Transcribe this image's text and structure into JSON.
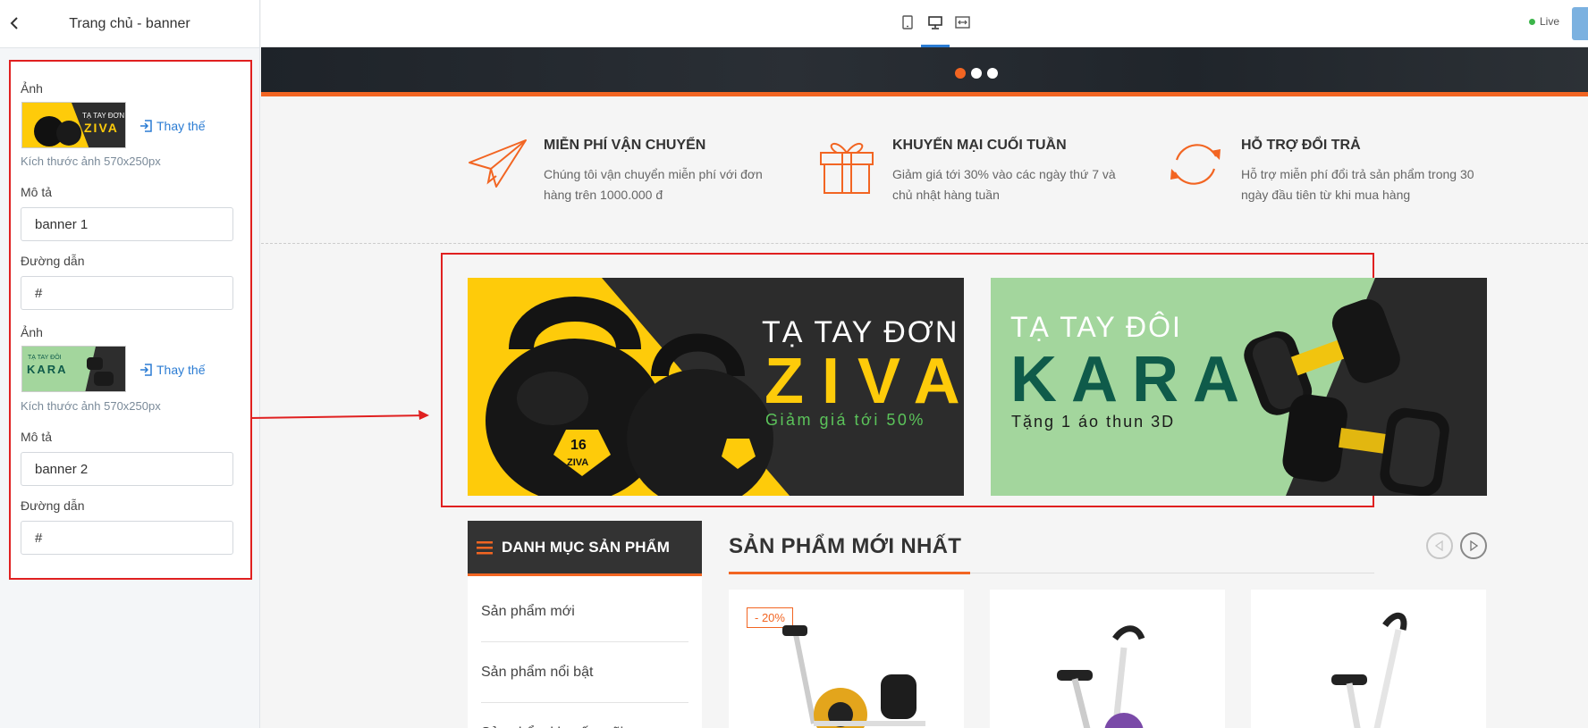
{
  "sidebar": {
    "title": "Trang chủ - banner",
    "banners": [
      {
        "image_label": "Ảnh",
        "replace_label": "Thay thế",
        "size_hint": "Kích thước ảnh 570x250px",
        "desc_label": "Mô tả",
        "desc_value": "banner 1",
        "link_label": "Đường dẫn",
        "link_value": "#"
      },
      {
        "image_label": "Ảnh",
        "replace_label": "Thay thế",
        "size_hint": "Kích thước ảnh 570x250px",
        "desc_label": "Mô tả",
        "desc_value": "banner 2",
        "link_label": "Đường dẫn",
        "link_value": "#"
      }
    ]
  },
  "topbar": {
    "live_label": "Live",
    "devices": [
      "mobile-icon",
      "desktop-icon",
      "fullwidth-icon"
    ],
    "active_device": "desktop"
  },
  "preview": {
    "slider_dots": 3,
    "features": [
      {
        "icon": "paper-plane-icon",
        "title": "MIỄN PHÍ VẬN CHUYỂN",
        "desc": "Chúng tôi vận chuyển miễn phí với đơn hàng trên 1000.000 đ"
      },
      {
        "icon": "gift-icon",
        "title": "KHUYẾN MẠI CUỐI TUẦN",
        "desc": "Giảm giá tới 30% vào các ngày thứ 7 và chủ nhật hàng tuần"
      },
      {
        "icon": "refresh-icon",
        "title": "HỖ TRỢ ĐỔI TRẢ",
        "desc": "Hỗ trợ miễn phí đổi trả sản phẩm trong 30 ngày đầu tiên từ khi mua hàng"
      }
    ],
    "banner1": {
      "line1": "TẠ TAY ĐƠN",
      "line2": "ZIVA",
      "line3": "Giảm giá tới 50%",
      "kettlebell_number": "16",
      "kettlebell_brand": "ZIVA"
    },
    "banner2": {
      "line1": "TẠ TAY ĐÔI",
      "line2": "KARA",
      "line3": "Tặng 1 áo thun 3D"
    },
    "thumb1": {
      "line1": "TẠ TAY ĐƠN",
      "line2": "ZIVA"
    },
    "thumb2": {
      "line1": "TẠ TAY ĐÔI",
      "line2": "KARA"
    },
    "category": {
      "title": "DANH MỤC SẢN PHẨM",
      "items": [
        "Sản phẩm mới",
        "Sản phẩm nổi bật",
        "Sản phẩm khuyến mãi"
      ]
    },
    "new_products": {
      "title": "SẢN PHẨM MỚI NHẤT",
      "sale_badge": "- 20%"
    }
  },
  "colors": {
    "accent": "#f26522",
    "highlight_border": "#e02020",
    "link_blue": "#2b7cd3",
    "banner1_yellow": "#fecb0a",
    "banner2_green": "#a3d69d",
    "kara_teal": "#0f5b4a"
  }
}
